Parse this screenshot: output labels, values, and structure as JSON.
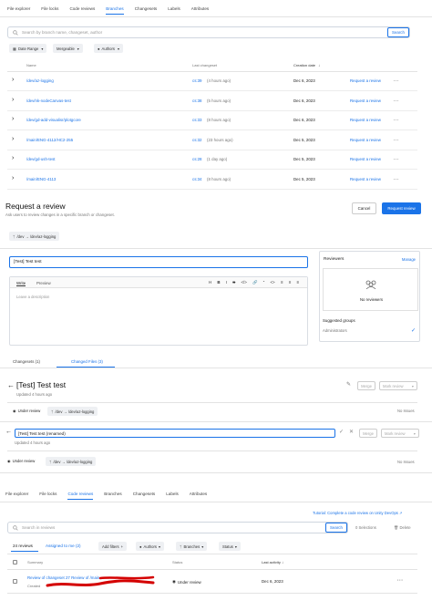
{
  "top": {
    "tabs": [
      "File explorer",
      "File locks",
      "Code reviews",
      "Branches",
      "Changesets",
      "Labels",
      "Attributes"
    ],
    "active_tab": 3,
    "search_placeholder": "Search by branch name, changeset, author",
    "search_button": "Search",
    "filters": [
      "Date Range",
      "Mergeable",
      "Authors"
    ],
    "columns": {
      "name": "Name",
      "last_changeset": "Last changeset",
      "creation_date": "Creation date"
    },
    "rows": [
      {
        "name": "/dev/az-logging",
        "cs": "cs:39",
        "cs_age": "(4 hours ago)",
        "date": "Dec 6, 2023",
        "action": "Request a review"
      },
      {
        "name": "/dev/nk-nodeCanvas-test",
        "cs": "cs:38",
        "cs_age": "(5 hours ago)",
        "date": "Dec 6, 2023",
        "action": "Request a review"
      },
      {
        "name": "/dev/gd-add-visualisr/plotgcore",
        "cs": "cs:33",
        "cs_age": "(8 hours ago)",
        "date": "Dec 6, 2023",
        "action": "Request a review"
      },
      {
        "name": "/main/ENG-4112/HC2-255",
        "cs": "cs:32",
        "cs_age": "(23 hours ago)",
        "date": "Dec 5, 2023",
        "action": "Request a review"
      },
      {
        "name": "/dev/gd-ush-test",
        "cs": "cs:28",
        "cs_age": "(1 day ago)",
        "date": "Dec 5, 2023",
        "action": "Request a review"
      },
      {
        "name": "/main/ENG-4113",
        "cs": "cs:34",
        "cs_age": "(8 hours ago)",
        "date": "Dec 5, 2023",
        "action": "Request a review"
      }
    ]
  },
  "request": {
    "title": "Request a review",
    "subtitle": "Ask users to review changes in a specific branch or changeset.",
    "cancel": "Cancel",
    "submit": "Request review",
    "branch_chip": "/dev → /dev/az-logging",
    "title_value": "[Test] Test test",
    "write_tab": "Write",
    "preview_tab": "Preview",
    "description_placeholder": "Leave a description",
    "reviewers_label": "Reviewers",
    "manage": "Manage",
    "no_reviewers": "No reviewers",
    "suggested_groups": "Suggested groups",
    "group_admins": "Administrators",
    "tab_changesets": "Changesets (1)",
    "tab_changed_files": "Changed Files (3)"
  },
  "review": {
    "title": "[Test] Test test",
    "updated": "Updated 4 hours ago",
    "merge": "Merge",
    "mark_review": "Mark review",
    "status": "Under review",
    "branch": "/dev → /dev/az-logging",
    "no_issues": "No Issues",
    "rename_value": "[Test] Test test (renamed)",
    "updated2": "Updated 4 hours ago",
    "no_issues2": "No Issues"
  },
  "bottom": {
    "tabs": [
      "File explorer",
      "File locks",
      "Code reviews",
      "Branches",
      "Changesets",
      "Labels",
      "Attributes"
    ],
    "active_tab": 2,
    "tutorial": "Tutorial: Complete a code review on Unity DevOps",
    "search_placeholder": "Search in reviews",
    "search_button": "Search",
    "selections": "0 Selections",
    "delete": "Delete",
    "count": "24 reviews",
    "assigned": "Assigned to me (2)",
    "add_filters": "Add filters",
    "filters": [
      "Authors",
      "Branches",
      "Status"
    ],
    "columns": {
      "summary": "Summary",
      "status": "Status",
      "last_activity": "Last activity"
    },
    "row": {
      "summary": "Review of changeset 27 Review of /main",
      "status": "Under review",
      "date": "Dec 6, 2023",
      "created": "Created"
    }
  },
  "colors": {
    "accent": "#1a73e8",
    "redaction": "#d40000"
  }
}
